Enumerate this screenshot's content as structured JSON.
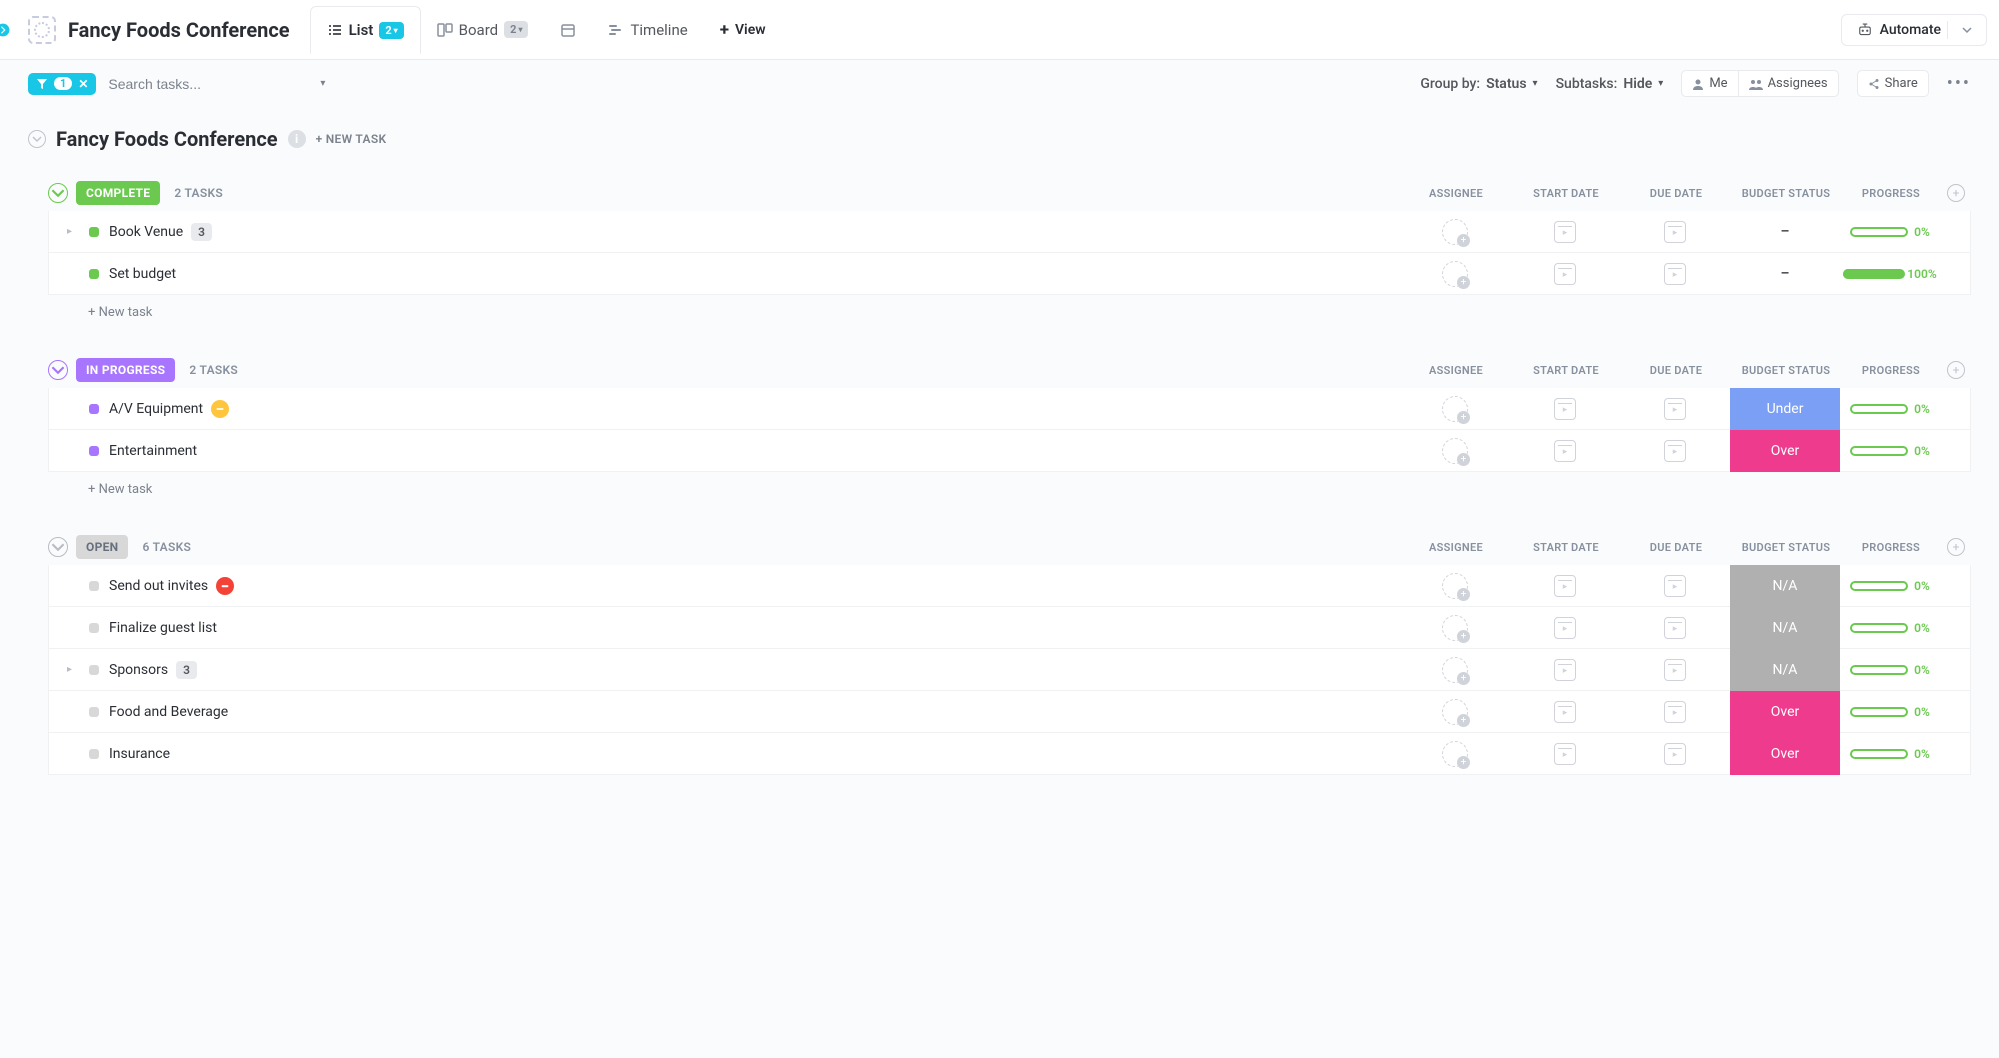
{
  "project_title": "Fancy Foods Conference",
  "views": {
    "list": {
      "label": "List",
      "count": "2"
    },
    "board": {
      "label": "Board",
      "count": "2"
    },
    "calendar": {
      "label": ""
    },
    "timeline": {
      "label": "Timeline"
    },
    "add": {
      "label": "View"
    }
  },
  "automate": {
    "label": "Automate"
  },
  "filter": {
    "count": "1"
  },
  "search": {
    "placeholder": "Search tasks..."
  },
  "groupby": {
    "label": "Group by:",
    "value": "Status"
  },
  "subtasks": {
    "label": "Subtasks:",
    "value": "Hide"
  },
  "buttons": {
    "me": "Me",
    "assignees": "Assignees",
    "share": "Share"
  },
  "list_header": {
    "title": "Fancy Foods Conference",
    "new_task": "+ NEW TASK"
  },
  "columns": {
    "assignee": "ASSIGNEE",
    "start_date": "START DATE",
    "due_date": "DUE DATE",
    "budget_status": "BUDGET STATUS",
    "progress": "PROGRESS"
  },
  "new_task_text": "+ New task",
  "groups": [
    {
      "status": "COMPLETE",
      "status_class": "complete",
      "collapse_color": "#6bc950",
      "count_text": "2 TASKS",
      "tasks": [
        {
          "name": "Book Venue",
          "subcount": "3",
          "has_expand": true,
          "budget": "–",
          "progress_pct": 0,
          "progress_label": "0%"
        },
        {
          "name": "Set budget",
          "budget": "–",
          "progress_pct": 100,
          "progress_label": "100%"
        }
      ]
    },
    {
      "status": "IN PROGRESS",
      "status_class": "inprogress",
      "collapse_color": "#a875ff",
      "count_text": "2 TASKS",
      "tasks": [
        {
          "name": "A/V Equipment",
          "priority": "yellow",
          "budget_type": "under",
          "budget_label": "Under",
          "progress_pct": 0,
          "progress_label": "0%"
        },
        {
          "name": "Entertainment",
          "budget_type": "over",
          "budget_label": "Over",
          "progress_pct": 0,
          "progress_label": "0%"
        }
      ]
    },
    {
      "status": "OPEN",
      "status_class": "open",
      "collapse_color": "#b8bcc5",
      "count_text": "6 TASKS",
      "tasks": [
        {
          "name": "Send out invites",
          "priority": "red",
          "budget_type": "na",
          "budget_label": "N/A",
          "progress_pct": 0,
          "progress_label": "0%"
        },
        {
          "name": "Finalize guest list",
          "budget_type": "na",
          "budget_label": "N/A",
          "progress_pct": 0,
          "progress_label": "0%"
        },
        {
          "name": "Sponsors",
          "subcount": "3",
          "has_expand": true,
          "budget_type": "na",
          "budget_label": "N/A",
          "progress_pct": 0,
          "progress_label": "0%"
        },
        {
          "name": "Food and Beverage",
          "budget_type": "over",
          "budget_label": "Over",
          "progress_pct": 0,
          "progress_label": "0%"
        },
        {
          "name": "Insurance",
          "budget_type": "over",
          "budget_label": "Over",
          "progress_pct": 0,
          "progress_label": "0%"
        }
      ]
    }
  ]
}
